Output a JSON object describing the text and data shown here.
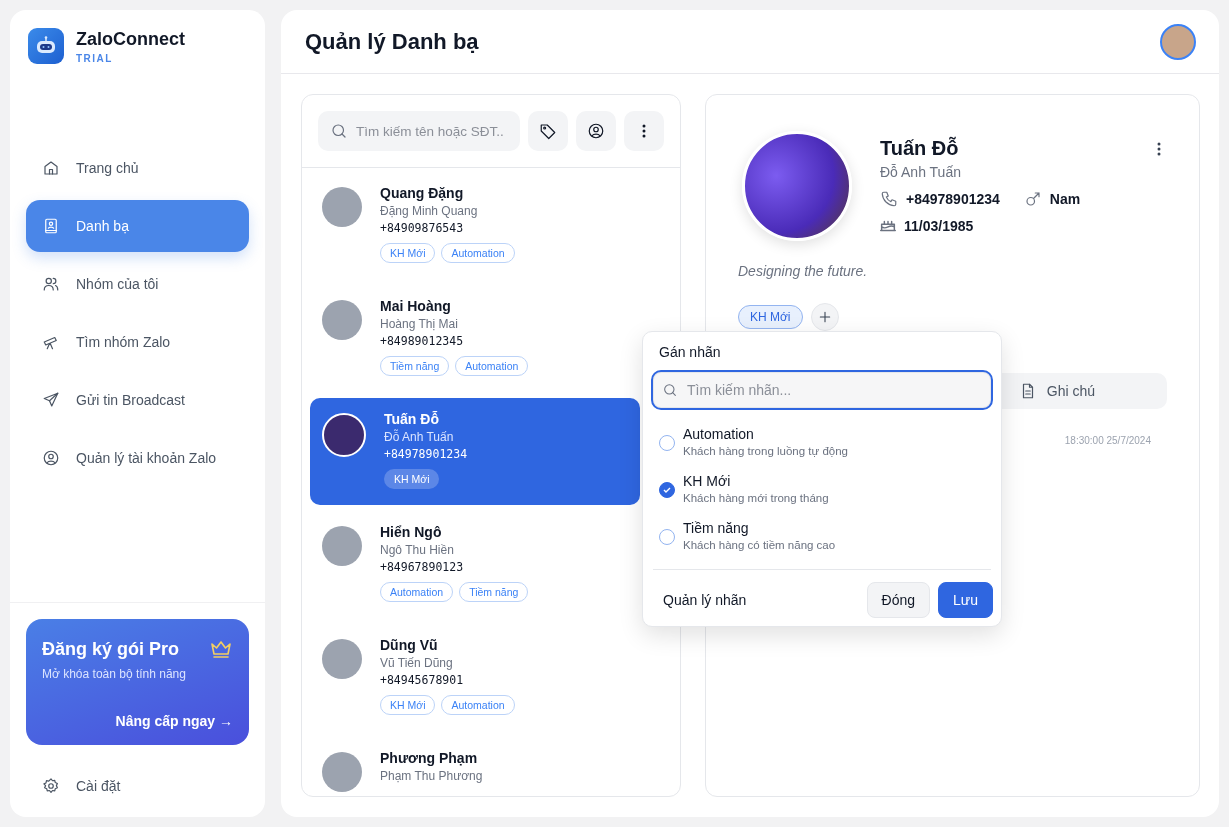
{
  "sidebar": {
    "app_name": "ZaloConnect",
    "plan_badge": "TRIAL",
    "items": [
      {
        "kind": "home",
        "label": "Trang chủ",
        "selected": false
      },
      {
        "kind": "contacts",
        "label": "Danh bạ",
        "selected": true
      },
      {
        "kind": "group",
        "label": "Nhóm của tôi",
        "selected": false
      },
      {
        "kind": "telescope",
        "label": "Tìm nhóm Zalo",
        "selected": false
      },
      {
        "kind": "send",
        "label": "Gửi tin Broadcast",
        "selected": false
      },
      {
        "kind": "account",
        "label": "Quản lý tài khoản Zalo",
        "selected": false
      }
    ],
    "promo": {
      "title": "Đăng ký gói Pro",
      "subtitle": "Mở khóa toàn bộ tính năng",
      "action": "Nâng cấp ngay →"
    },
    "settings": "Cài đặt"
  },
  "page_title": "Quản lý Danh bạ",
  "contact_list": {
    "search_placeholder": "Tìm kiếm tên hoặc SĐT..",
    "contacts": [
      {
        "name": "Quang Đặng",
        "full_name": "Đặng Minh Quang",
        "phone": "+84909876543",
        "tags": [
          "KH Mới",
          "Automation"
        ],
        "selected": false
      },
      {
        "name": "Mai Hoàng",
        "full_name": "Hoàng Thị Mai",
        "phone": "+84989012345",
        "tags": [
          "Tiềm năng",
          "Automation"
        ],
        "selected": false
      },
      {
        "name": "Tuấn Đỗ",
        "full_name": "Đỗ Anh Tuấn",
        "phone": "+84978901234",
        "tags": [
          "KH Mới"
        ],
        "selected": true
      },
      {
        "name": "Hiển Ngô",
        "full_name": "Ngô Thu Hiền",
        "phone": "+84967890123",
        "tags": [
          "Automation",
          "Tiềm năng"
        ],
        "selected": false
      },
      {
        "name": "Dũng Vũ",
        "full_name": "Vũ Tiến Dũng",
        "phone": "+84945678901",
        "tags": [
          "KH Mới",
          "Automation"
        ],
        "selected": false
      },
      {
        "name": "Phương Phạm",
        "full_name": "Phạm Thu Phương",
        "selected": false
      }
    ]
  },
  "detail": {
    "name": "Tuấn Đỗ",
    "full_name": "Đỗ Anh Tuấn",
    "phone": "+84978901234",
    "gender": "Nam",
    "birthday": "11/03/1985",
    "bio": "Designing the future.",
    "tags": [
      "KH Mới"
    ],
    "notes_tab": "Ghi chú",
    "timestamp": "18:30:00 25/7/2024"
  },
  "label_popover": {
    "title": "Gán nhãn",
    "search_placeholder": "Tìm kiếm nhãn...",
    "options": [
      {
        "name": "Automation",
        "description": "Khách hàng trong luồng tự động",
        "checked": false
      },
      {
        "name": "KH Mới",
        "description": "Khách hàng mới trong tháng",
        "checked": true
      },
      {
        "name": "Tiềm năng",
        "description": "Khách hàng có tiềm năng cao",
        "checked": false
      }
    ],
    "manage": "Quản lý nhãn",
    "close": "Đóng",
    "save": "Lưu"
  }
}
